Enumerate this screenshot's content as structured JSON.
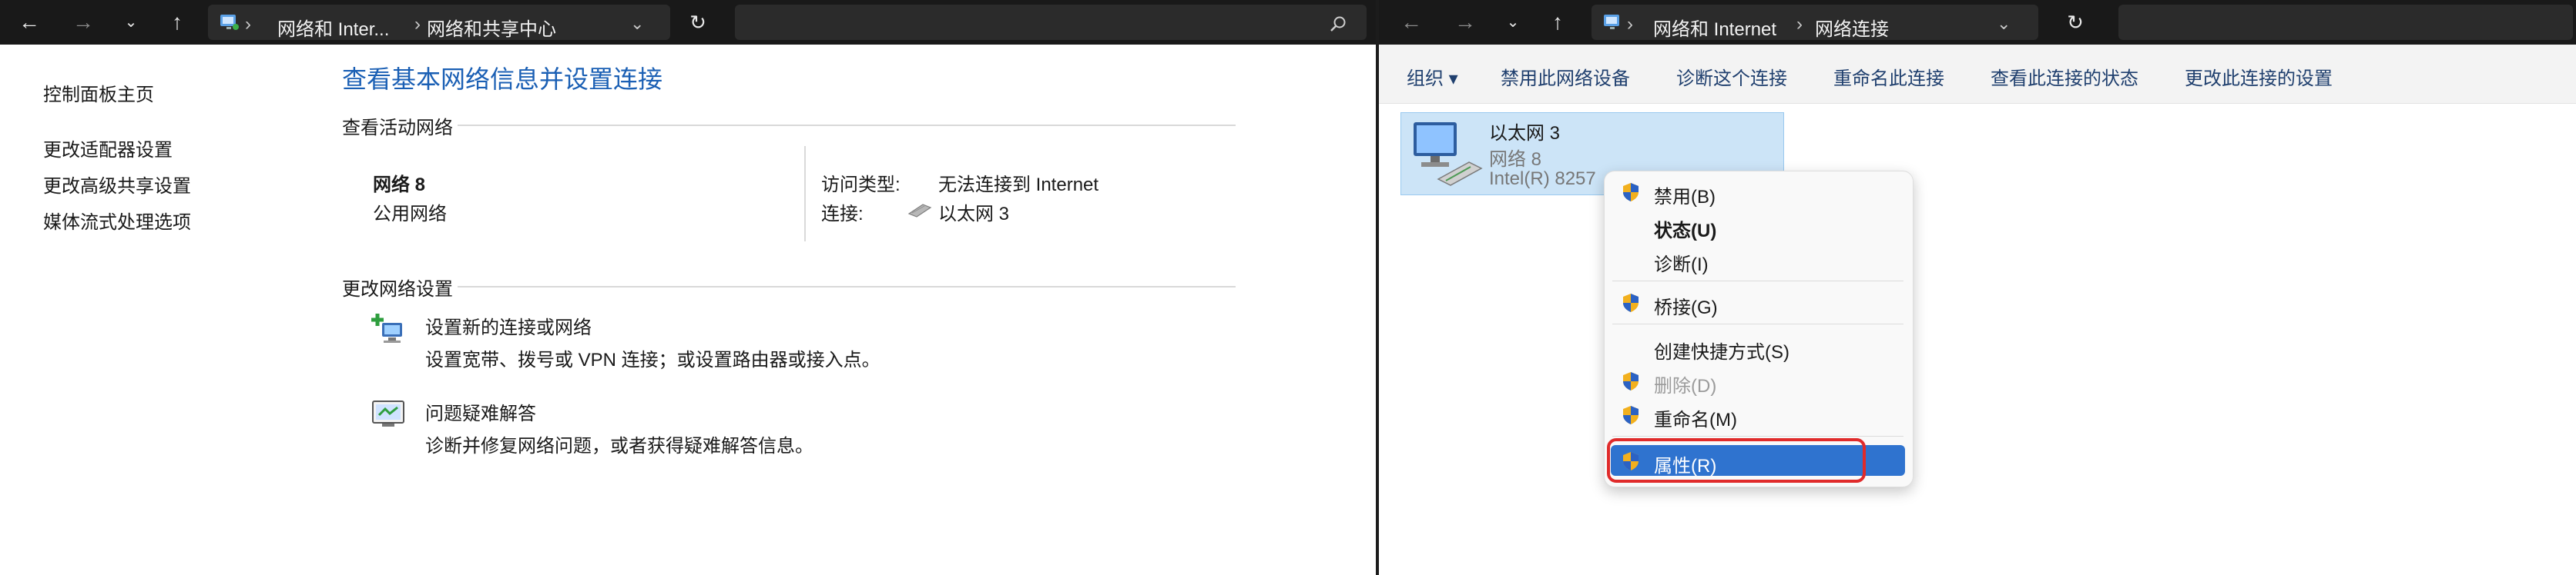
{
  "left_window": {
    "breadcrumb": [
      "网络和 Inter...",
      "网络和共享中心"
    ],
    "sidebar": {
      "items": [
        "控制面板主页",
        "更改适配器设置",
        "更改高级共享设置",
        "媒体流式处理选项"
      ]
    },
    "page_title": "查看基本网络信息并设置连接",
    "active_section_title": "查看活动网络",
    "network": {
      "name": "网络 8",
      "category": "公用网络",
      "access_type_label": "访问类型:",
      "access_type_value": "无法连接到 Internet",
      "connection_label": "连接:",
      "connection_value": "以太网 3"
    },
    "settings_section_title": "更改网络设置",
    "tasks": [
      {
        "title": "设置新的连接或网络",
        "desc": "设置宽带、拨号或 VPN 连接；或设置路由器或接入点。"
      },
      {
        "title": "问题疑难解答",
        "desc": "诊断并修复网络问题，或者获得疑难解答信息。"
      }
    ]
  },
  "right_window": {
    "breadcrumb": [
      "网络和 Internet",
      "网络连接"
    ],
    "toolbar": {
      "organize": "组织",
      "items": [
        "禁用此网络设备",
        "诊断这个连接",
        "重命名此连接",
        "查看此连接的状态",
        "更改此连接的设置"
      ]
    },
    "adapter": {
      "name": "以太网 3",
      "network": "网络 8",
      "device": "Intel(R) 8257"
    },
    "context_menu": {
      "items": [
        {
          "label": "禁用(B)",
          "shield": true
        },
        {
          "label": "状态(U)",
          "bold": true
        },
        {
          "label": "诊断(I)"
        },
        {
          "label": "桥接(G)",
          "shield": true
        },
        {
          "label": "创建快捷方式(S)"
        },
        {
          "label": "删除(D)",
          "shield": true,
          "disabled": true
        },
        {
          "label": "重命名(M)",
          "shield": true
        },
        {
          "label": "属性(R)",
          "shield": true,
          "selected": true
        }
      ]
    },
    "highlight_color": "#e02b2b",
    "selection_color": "#2f73cf"
  }
}
